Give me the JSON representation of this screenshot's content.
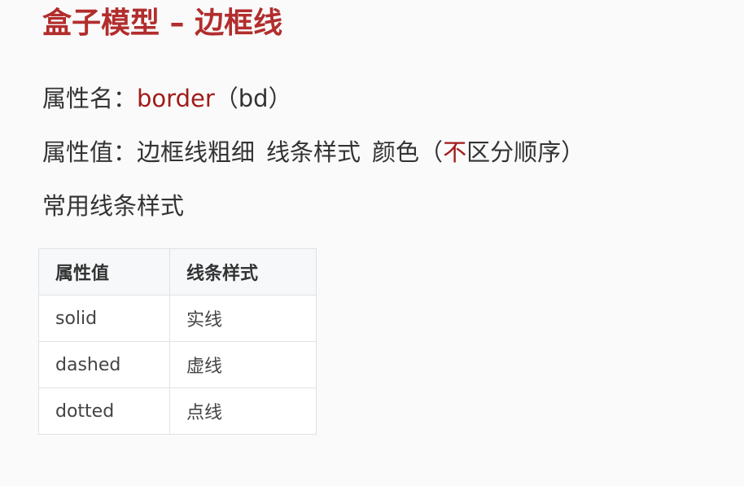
{
  "title": "盒子模型 – 边框线",
  "property_name": {
    "label": "属性名：",
    "value": "border",
    "alias": "（bd）"
  },
  "property_value": {
    "label": "属性值：",
    "part1": "边框线粗细",
    "part2": "线条样式",
    "part3": "颜色（",
    "emphasis": "不",
    "part4": "区分顺序）"
  },
  "common_styles_heading": "常用线条样式",
  "table": {
    "headers": [
      "属性值",
      "线条样式"
    ],
    "rows": [
      [
        "solid",
        "实线"
      ],
      [
        "dashed",
        "虚线"
      ],
      [
        "dotted",
        "点线"
      ]
    ]
  },
  "colors": {
    "title": "#b22d2d",
    "highlight": "#a11b1b",
    "text": "#333333",
    "border": "#dfe2e5"
  }
}
